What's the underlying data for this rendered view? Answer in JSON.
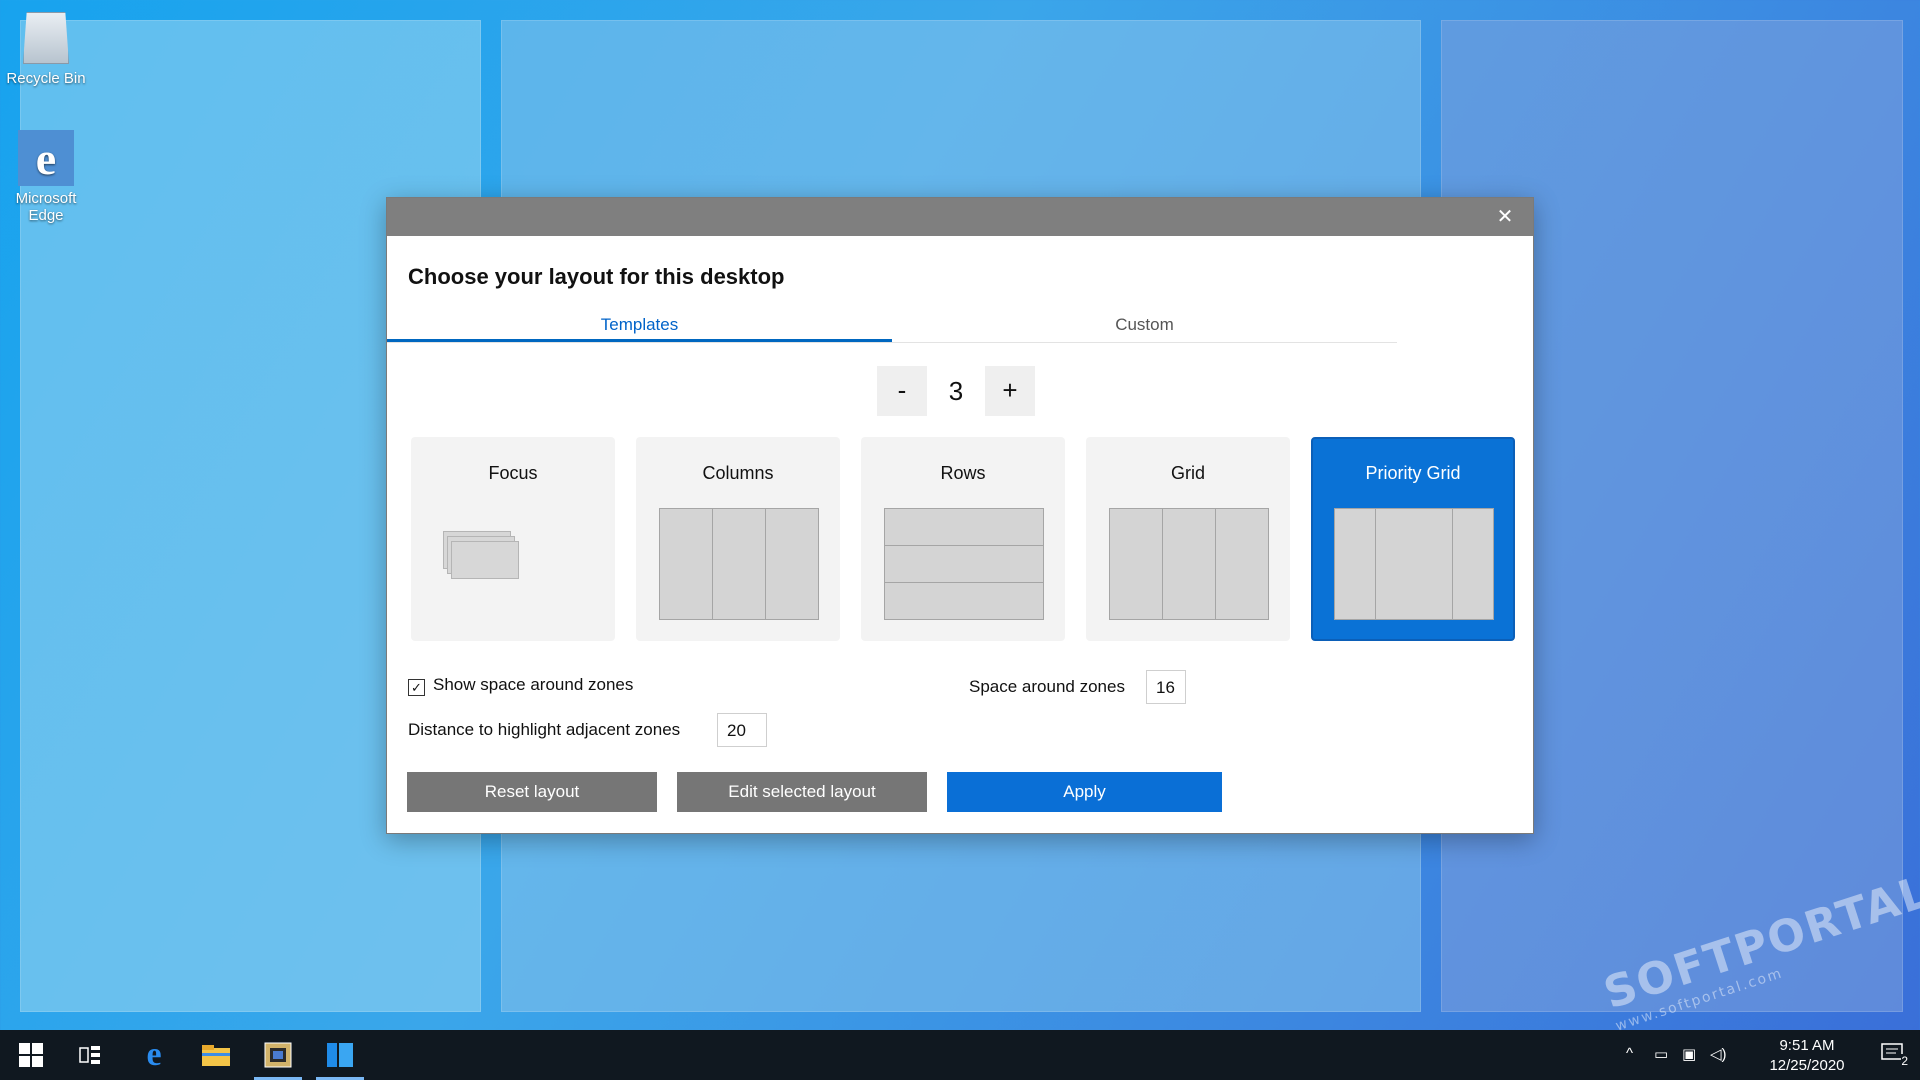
{
  "desktop": {
    "icons": [
      {
        "label": "Recycle Bin",
        "icon": "recycle-bin-icon"
      },
      {
        "label": "Microsoft Edge",
        "icon": "edge-icon"
      }
    ]
  },
  "dialog": {
    "title": "Choose your layout for this desktop",
    "close_glyph": "✕",
    "tabs": [
      {
        "label": "Templates",
        "selected": true
      },
      {
        "label": "Custom",
        "selected": false
      }
    ],
    "zone_count": {
      "minus": "-",
      "value": "3",
      "plus": "+"
    },
    "layouts": [
      {
        "label": "Focus",
        "selected": false
      },
      {
        "label": "Columns",
        "selected": false
      },
      {
        "label": "Rows",
        "selected": false
      },
      {
        "label": "Grid",
        "selected": false
      },
      {
        "label": "Priority Grid",
        "selected": true
      }
    ],
    "show_space_around_zones": {
      "label": "Show space around zones",
      "checked": true,
      "check_glyph": "✓"
    },
    "space_around_zones": {
      "label": "Space around zones",
      "value": "16"
    },
    "distance_highlight": {
      "label": "Distance to highlight adjacent zones",
      "value": "20"
    },
    "buttons": {
      "reset": "Reset layout",
      "edit": "Edit selected layout",
      "apply": "Apply"
    },
    "accent_color": "#0a6fd6"
  },
  "taskbar": {
    "clock_time": "9:51 AM",
    "clock_date": "12/25/2020",
    "notification_count": "2",
    "items": [
      {
        "name": "start-button",
        "icon": "windows-logo-icon"
      },
      {
        "name": "task-view-button",
        "icon": "task-view-icon"
      },
      {
        "name": "edge-taskbar-button",
        "icon": "edge-icon"
      },
      {
        "name": "file-explorer-button",
        "icon": "folder-icon"
      },
      {
        "name": "powertoys-button",
        "icon": "powertoys-icon"
      },
      {
        "name": "fancyzones-button",
        "icon": "fancyzones-icon"
      }
    ]
  },
  "watermark": {
    "text": "SOFTPORTAL",
    "subtext": "www.softportal.com"
  }
}
